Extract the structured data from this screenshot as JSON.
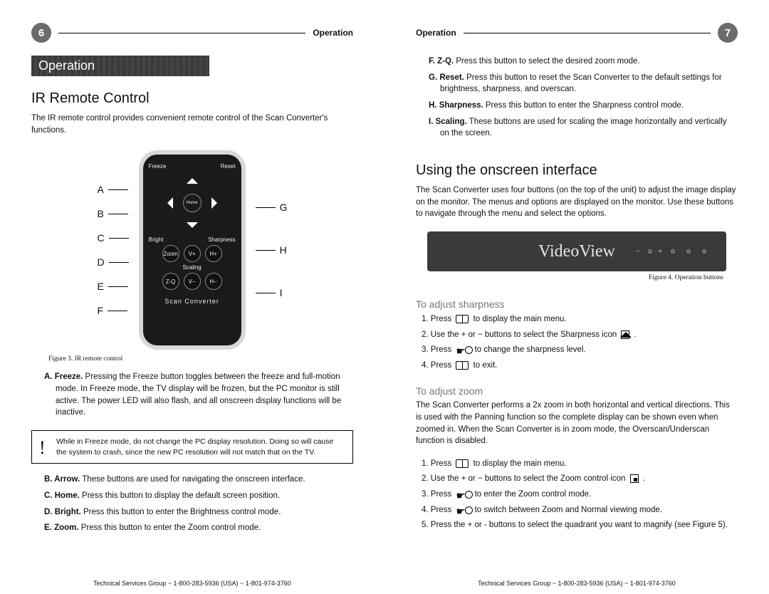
{
  "pages": {
    "left": {
      "number": "6",
      "header": "Operation"
    },
    "right": {
      "number": "7",
      "header": "Operation"
    }
  },
  "section_title": "Operation",
  "ir": {
    "heading": "IR Remote Control",
    "intro": "The IR remote control provides convenient remote control of the Scan Converter's functions.",
    "callouts_left": [
      "A",
      "B",
      "C",
      "D",
      "E",
      "F"
    ],
    "callouts_right": [
      "G",
      "H",
      "I"
    ],
    "remote": {
      "top_left": "Freeze",
      "top_right": "Reset",
      "home": "Home",
      "mid_left": "Bright",
      "mid_right": "Sharpness",
      "btns": [
        "Zoom",
        "V+",
        "H+",
        "Scaling",
        "Z-Q",
        "V−",
        "H−"
      ],
      "brand": "Scan Converter"
    },
    "figcap": "Figure 3. IR remote control",
    "defs_p1": [
      {
        "lead": "A.",
        "term": "Freeze.",
        "text": " Pressing the Freeze button toggles between the freeze and full-motion mode. In Freeze mode, the TV display will be frozen, but the PC monitor is still active. The power LED will also flash, and all onscreen display functions will be inactive."
      }
    ],
    "note": "While in Freeze mode, do not change the PC display resolution. Doing so will cause the system to crash, since the new PC resolution will not match that on the TV.",
    "defs_p2": [
      {
        "lead": "B.",
        "term": "Arrow.",
        "text": " These buttons are used for navigating the onscreen interface."
      },
      {
        "lead": "C.",
        "term": "Home.",
        "text": " Press this button to display the default screen position."
      },
      {
        "lead": "D.",
        "term": "Bright.",
        "text": " Press this button to enter the Brightness control mode."
      },
      {
        "lead": "E.",
        "term": "Zoom.",
        "text": " Press this button to enter the Zoom control mode."
      }
    ]
  },
  "right_defs": [
    {
      "lead": "F.",
      "term": "Z-Q.",
      "text": " Press this button to select the desired zoom mode."
    },
    {
      "lead": "G.",
      "term": "Reset.",
      "text": " Press this button to reset the Scan Converter to the default settings for brightness, sharpness, and overscan."
    },
    {
      "lead": "H.",
      "term": "Sharpness.",
      "text": " Press this button to enter the Sharpness control mode."
    },
    {
      "lead": "I.",
      "term": "Scaling.",
      "text": " These buttons are used for scaling the image horizontally and vertically on the screen."
    }
  ],
  "osi": {
    "heading": "Using the onscreen interface",
    "intro": "The Scan Converter uses four buttons (on the top of the unit) to adjust the image display on the monitor. The menus and options are displayed on the monitor. Use these buttons to navigate through the menu and select the options.",
    "brand": "VideoView",
    "figcap": "Figure 4. Operation buttons",
    "sharp_heading": "To adjust sharpness",
    "sharp_steps": [
      {
        "pre": "Press ",
        "icon": "book",
        "post": " to display the main menu."
      },
      {
        "pre": "Use the + or − buttons to select the Sharpness icon ",
        "icon": "house",
        "post": " ."
      },
      {
        "pre": "Press ",
        "icon": "hand",
        "post": " to change the sharpness level."
      },
      {
        "pre": "Press ",
        "icon": "book",
        "post": " to exit."
      }
    ],
    "zoom_heading": "To adjust zoom",
    "zoom_intro": "The Scan Converter performs a 2x zoom in both horizontal and vertical directions. This is used with the Panning function so the complete display can be shown even when zoomed in. When the Scan Converter is in zoom mode, the Overscan/Underscan function is disabled.",
    "zoom_steps": [
      {
        "pre": "Press ",
        "icon": "book",
        "post": " to display the main menu."
      },
      {
        "pre": "Use the + or − buttons to select the Zoom control icon ",
        "icon": "zoom",
        "post": " ."
      },
      {
        "pre": "Press ",
        "icon": "hand",
        "post": " to enter the Zoom control mode."
      },
      {
        "pre": "Press ",
        "icon": "hand",
        "post": " to switch between Zoom and Normal viewing mode."
      },
      {
        "pre": "Press the + or - buttons to select the quadrant you want to magnify (see Figure 5).",
        "icon": "",
        "post": ""
      }
    ]
  },
  "footer": "Technical Services Group ~ 1-800-283-5936 (USA) ~ 1-801-974-3760"
}
